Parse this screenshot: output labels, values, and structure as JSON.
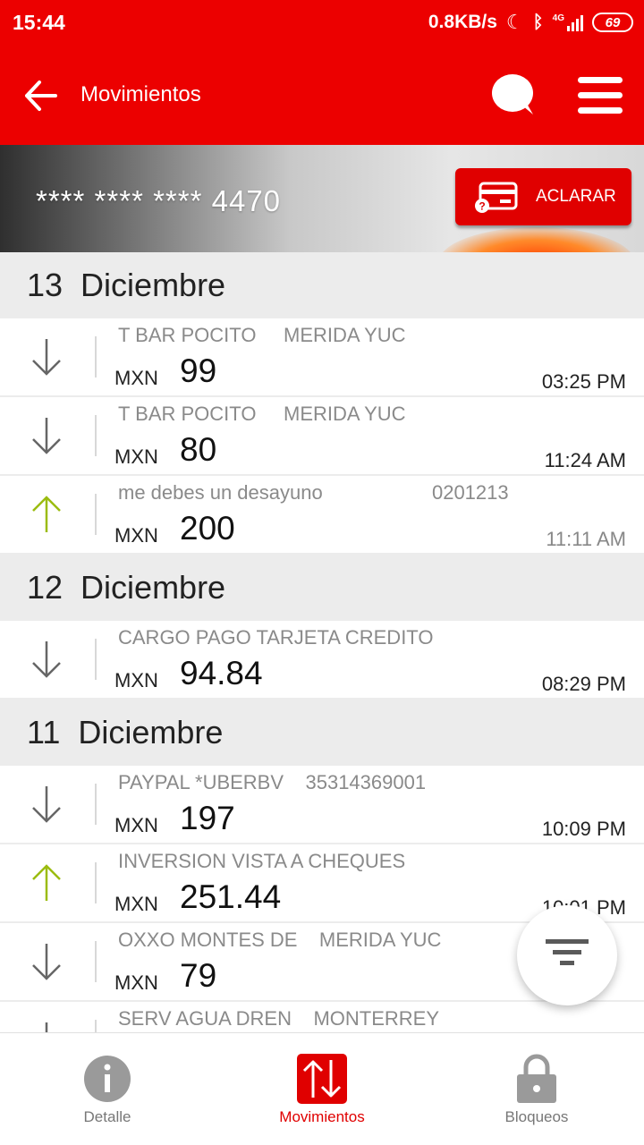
{
  "status_bar": {
    "time": "15:44",
    "network_speed": "0.8KB/s",
    "network_type": "4G",
    "battery": "69"
  },
  "app_bar": {
    "title": "Movimientos"
  },
  "card": {
    "masked_number": "**** **** **** 4470",
    "aclarar_label": "ACLARAR"
  },
  "sections": [
    {
      "day": "13",
      "month": "Diciembre",
      "transactions": [
        {
          "description": "T BAR POCITO     MERIDA YUC",
          "currency": "MXN",
          "amount": "99",
          "time": "03:25 PM",
          "direction": "out"
        },
        {
          "description": "T BAR POCITO     MERIDA YUC",
          "currency": "MXN",
          "amount": "80",
          "time": "11:24 AM",
          "direction": "out"
        },
        {
          "description": "me debes un desayuno                    0201213",
          "currency": "MXN",
          "amount": "200",
          "time": "11:11 AM",
          "direction": "in"
        }
      ]
    },
    {
      "day": "12",
      "month": "Diciembre",
      "transactions": [
        {
          "description": "CARGO PAGO TARJETA CREDITO",
          "currency": "MXN",
          "amount": "94.84",
          "time": "08:29 PM",
          "direction": "out"
        }
      ]
    },
    {
      "day": "11",
      "month": "Diciembre",
      "transactions": [
        {
          "description": "PAYPAL *UBERBV    35314369001",
          "currency": "MXN",
          "amount": "197",
          "time": "10:09 PM",
          "direction": "out"
        },
        {
          "description": "INVERSION VISTA A CHEQUES",
          "currency": "MXN",
          "amount": "251.44",
          "time": "10:01 PM",
          "direction": "in"
        },
        {
          "description": "OXXO MONTES DE    MERIDA YUC",
          "currency": "MXN",
          "amount": "79",
          "time": "",
          "direction": "out"
        },
        {
          "description": "SERV AGUA DREN    MONTERREY",
          "currency": "",
          "amount": "",
          "time": "",
          "direction": "out"
        }
      ]
    }
  ],
  "bottom_nav": {
    "items": [
      {
        "label": "Detalle",
        "icon": "info-icon"
      },
      {
        "label": "Movimientos",
        "icon": "transfer-arrows-icon"
      },
      {
        "label": "Bloqueos",
        "icon": "lock-icon"
      }
    ],
    "active": "Movimientos"
  },
  "colors": {
    "brand_red": "#ec0000",
    "arrow_out": "#666666",
    "arrow_in": "#9bbc10"
  }
}
